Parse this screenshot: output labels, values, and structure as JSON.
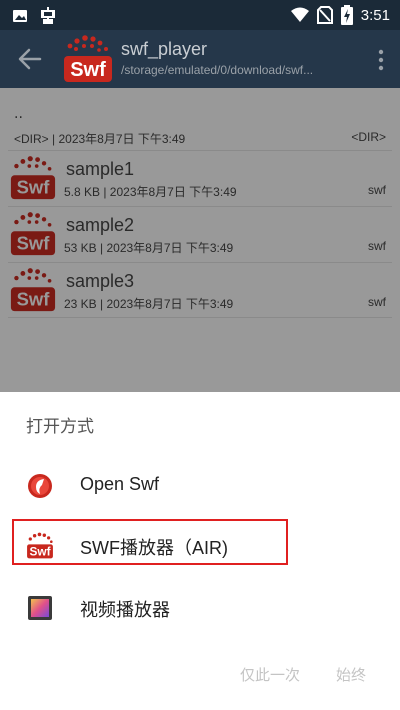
{
  "status_bar": {
    "time": "3:51",
    "left_icons": [
      "image-icon",
      "bug-icon"
    ],
    "right_icons": [
      "wifi-icon",
      "no-sim-icon",
      "battery-charging-icon"
    ]
  },
  "toolbar": {
    "title": "swf_player",
    "path": "/storage/emulated/0/download/swf...",
    "logo_text": "Swf"
  },
  "file_list": {
    "parent_dir": {
      "name": "..",
      "info": "<DIR> | 2023年8月7日 下午3:49",
      "tag": "<DIR>"
    },
    "files": [
      {
        "name": "sample1",
        "info": "5.8 KB | 2023年8月7日 下午3:49",
        "type": "swf",
        "icon_text": "Swf"
      },
      {
        "name": "sample2",
        "info": "53 KB | 2023年8月7日 下午3:49",
        "type": "swf",
        "icon_text": "Swf"
      },
      {
        "name": "sample3",
        "info": "23 KB | 2023年8月7日 下午3:49",
        "type": "swf",
        "icon_text": "Swf"
      }
    ]
  },
  "chooser": {
    "title": "打开方式",
    "options": [
      {
        "label": "Open Swf",
        "icon": "open-swf-app-icon"
      },
      {
        "label": "SWF播放器（AIR)",
        "icon": "swf-player-air-icon",
        "icon_text": "Swf",
        "highlighted": true
      },
      {
        "label": "视频播放器",
        "icon": "video-player-icon"
      }
    ],
    "just_once": "仅此一次",
    "always": "始终"
  },
  "colors": {
    "status_bar": "#1b2a38",
    "toolbar": "#25374a",
    "dim_overlay": "#999999",
    "logo_red": "#c8281e",
    "highlight": "#e02020"
  }
}
